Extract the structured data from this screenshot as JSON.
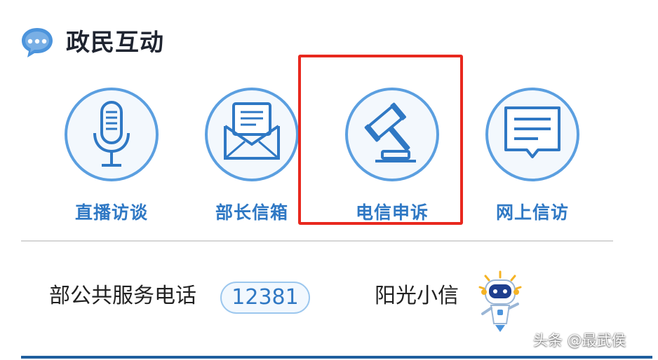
{
  "header": {
    "title": "政民互动",
    "icon": "chat-bubble-icon"
  },
  "services": [
    {
      "label": "直播访谈",
      "icon": "microphone-icon"
    },
    {
      "label": "部长信箱",
      "icon": "mailbox-icon"
    },
    {
      "label": "电信申诉",
      "icon": "gavel-icon",
      "highlighted": true
    },
    {
      "label": "网上信访",
      "icon": "message-board-icon"
    }
  ],
  "hotline": {
    "label": "部公共服务电话",
    "number": "12381"
  },
  "assistant": {
    "label": "阳光小信",
    "icon": "robot-mascot-icon"
  },
  "watermark": {
    "text": "头条 @最武侯"
  },
  "colors": {
    "accent": "#2f78c4",
    "circle_fill": "#f3f8fd",
    "highlight": "#e8281e",
    "text": "#222222"
  }
}
